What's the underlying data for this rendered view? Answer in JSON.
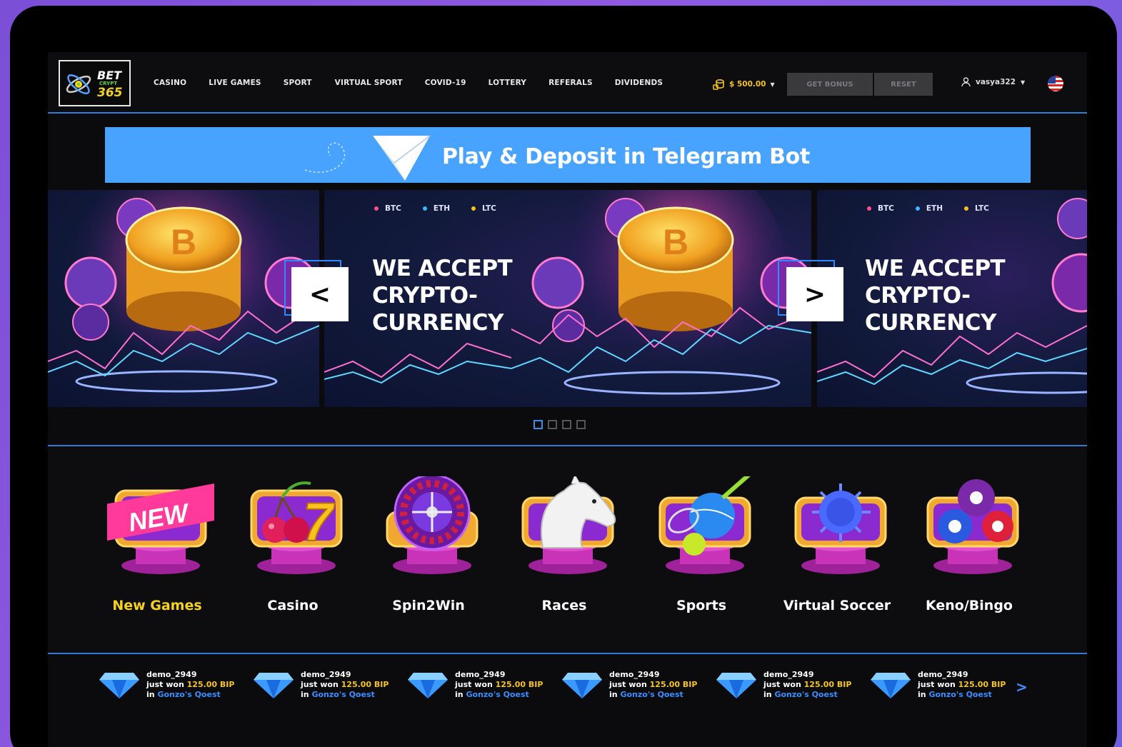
{
  "header": {
    "logo": {
      "line1": "BET",
      "line2": "CRYPT",
      "line3": "365"
    },
    "nav": [
      "CASINO",
      "LIVE GAMES",
      "SPORT",
      "VIRTUAL SPORT",
      "COVID-19",
      "LOTTERY",
      "REFERALS",
      "DIVIDENDS"
    ],
    "balance": "$ 500.00",
    "get_bonus": "GET BONUS",
    "reset": "RESET",
    "username": "vasya322"
  },
  "telegram_banner": {
    "text": "Play & Deposit in Telegram Bot"
  },
  "carousel": {
    "tags": [
      "BTC",
      "ETH",
      "LTC"
    ],
    "tag_colors": [
      "#ff4f8b",
      "#38b8ff",
      "#f5c21f"
    ],
    "headline_line1": "WE ACCEPT",
    "headline_line2": "CRYPTO-",
    "headline_line3": "CURRENCY",
    "prev_label": "<",
    "next_label": ">",
    "pages": 4,
    "active_page": 1
  },
  "categories": [
    {
      "label": "New Games",
      "icon": "new-badge-icon"
    },
    {
      "label": "Casino",
      "icon": "cherries-seven-icon"
    },
    {
      "label": "Spin2Win",
      "icon": "roulette-icon"
    },
    {
      "label": "Races",
      "icon": "horse-icon"
    },
    {
      "label": "Sports",
      "icon": "sports-balls-icon"
    },
    {
      "label": "Virtual Soccer",
      "icon": "virus-icon"
    },
    {
      "label": "Keno/Bingo",
      "icon": "billiard-balls-icon"
    }
  ],
  "new_badge": "NEW",
  "winners": [
    {
      "user": "demo_2949",
      "prefix": "just won",
      "amount": "125.00 BIP",
      "in": "in",
      "game": "Gonzo's Qoest"
    },
    {
      "user": "demo_2949",
      "prefix": "just won",
      "amount": "125.00 BIP",
      "in": "in",
      "game": "Gonzo's Qoest"
    },
    {
      "user": "demo_2949",
      "prefix": "just won",
      "amount": "125.00 BIP",
      "in": "in",
      "game": "Gonzo's Qoest"
    },
    {
      "user": "demo_2949",
      "prefix": "just won",
      "amount": "125.00 BIP",
      "in": "in",
      "game": "Gonzo's Qoest"
    },
    {
      "user": "demo_2949",
      "prefix": "just won",
      "amount": "125.00 BIP",
      "in": "in",
      "game": "Gonzo's Qoest"
    },
    {
      "user": "demo_2949",
      "prefix": "just won",
      "amount": "125.00 BIP",
      "in": "in",
      "game": "Gonzo's Qoest"
    }
  ],
  "ticker_next": ">",
  "colors": {
    "accent_blue": "#2f7ad6",
    "gold": "#f5c41f",
    "telegram": "#48a3ff"
  }
}
